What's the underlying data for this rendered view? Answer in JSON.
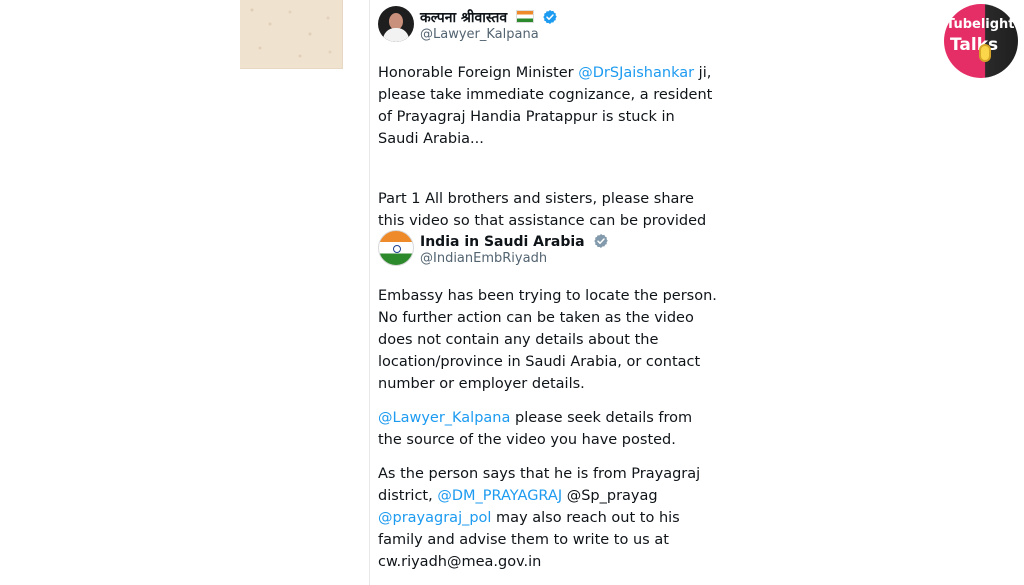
{
  "branding": {
    "logo_line1": "Tubelight",
    "logo_line2": "Talks",
    "logo_colors": {
      "pink": "#e62e66",
      "dark": "#1f1f1f",
      "mic": "#fbd54a"
    }
  },
  "colors": {
    "link": "#1d9bf0",
    "handle": "#536471",
    "text": "#0f1419"
  },
  "tweet": {
    "author_name": "कल्पना श्रीवास्तव",
    "author_handle": "@Lawyer_Kalpana",
    "verified": true,
    "line1_a": "Honorable Foreign Minister ",
    "line1_mention": "@DrSJaishankar",
    "line1_b": " ji, please take immediate cognizance, a resident of Prayagraj Handia Pratappur is stuck in Saudi Arabia...",
    "line2": "Part 1 All brothers and sisters, please share this video so that assistance can be provided",
    "emoji": "pray-hands-icon"
  },
  "quote": {
    "author_name": "India in Saudi Arabia",
    "author_handle": "@IndianEmbRiyadh",
    "verified": true,
    "para1": "Embassy has been trying to locate the person. No further action can be taken as the video does not contain any details about the location/province in Saudi Arabia, or contact number or employer details.",
    "para2_mention": "@Lawyer_Kalpana",
    "para2_text": " please seek details from the source of the video you have posted.",
    "para3_a": "As the person says that he is from Prayagraj district, ",
    "para3_mention1": "@DM_PRAYAGRAJ",
    "para3_b": " @Sp_prayag ",
    "para3_mention2": "@prayagraj_pol",
    "para3_c": " may also reach out to his family and advise them to write to us at cw.riyadh@mea.gov.in"
  }
}
